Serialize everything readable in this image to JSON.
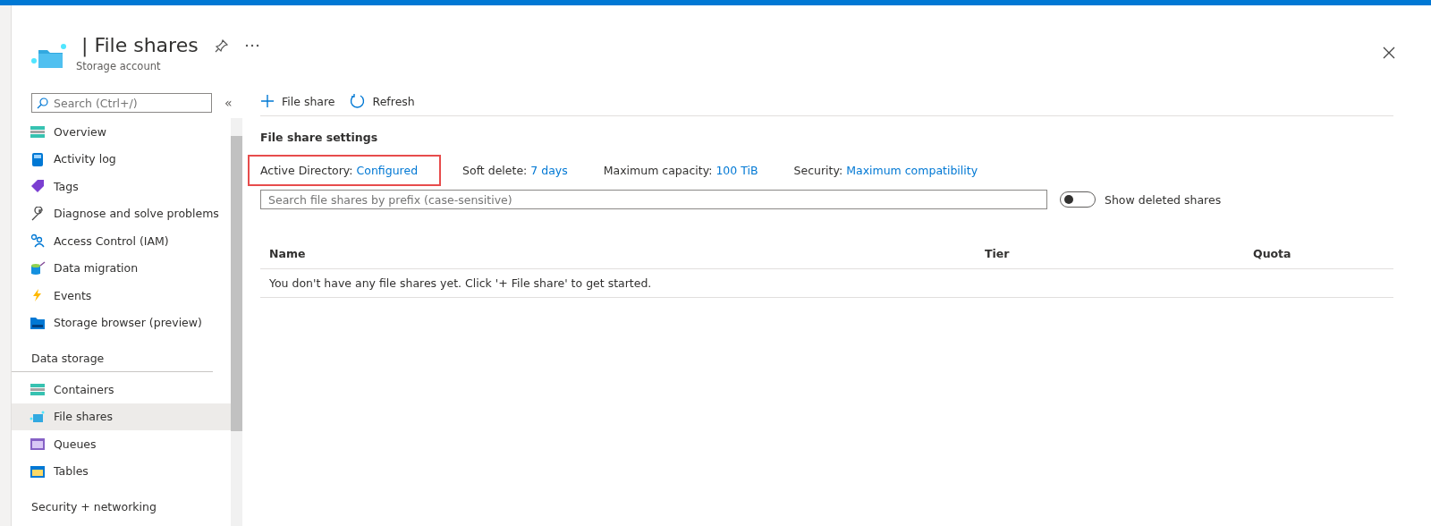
{
  "header": {
    "title": "| File shares",
    "subtitle": "Storage account"
  },
  "sidebar": {
    "search": {
      "placeholder": "Search (Ctrl+/)"
    },
    "collapse": "«",
    "items": [
      {
        "kind": "item",
        "label": "Overview",
        "selected": false
      },
      {
        "kind": "item",
        "label": "Activity log",
        "selected": false
      },
      {
        "kind": "item",
        "label": "Tags",
        "selected": false
      },
      {
        "kind": "item",
        "label": "Diagnose and solve problems",
        "selected": false
      },
      {
        "kind": "item",
        "label": "Access Control (IAM)",
        "selected": false
      },
      {
        "kind": "item",
        "label": "Data migration",
        "selected": false
      },
      {
        "kind": "item",
        "label": "Events",
        "selected": false
      },
      {
        "kind": "item",
        "label": "Storage browser (preview)",
        "selected": false
      },
      {
        "kind": "section",
        "label": "Data storage"
      },
      {
        "kind": "item",
        "label": "Containers",
        "selected": false
      },
      {
        "kind": "item",
        "label": "File shares",
        "selected": true
      },
      {
        "kind": "item",
        "label": "Queues",
        "selected": false
      },
      {
        "kind": "item",
        "label": "Tables",
        "selected": false
      },
      {
        "kind": "section",
        "label": "Security + networking"
      }
    ]
  },
  "toolbar": [
    {
      "label": "File share"
    },
    {
      "label": "Refresh"
    }
  ],
  "settings": {
    "title": "File share settings",
    "items": [
      {
        "label": "Active Directory:",
        "value": "Configured",
        "highlighted": true
      },
      {
        "label": "Soft delete:",
        "value": "7 days",
        "highlighted": false
      },
      {
        "label": "Maximum capacity:",
        "value": "100 TiB",
        "highlighted": false
      },
      {
        "label": "Security:",
        "value": "Maximum compatibility",
        "highlighted": false
      }
    ]
  },
  "filter": {
    "placeholder": "Search file shares by prefix (case-sensitive)"
  },
  "show_deleted": {
    "label": "Show deleted shares",
    "on": false
  },
  "table": {
    "columns": [
      "Name",
      "",
      "Tier",
      "Quota"
    ],
    "empty_message": "You don't have any file shares yet. Click '+ File share' to get started."
  }
}
